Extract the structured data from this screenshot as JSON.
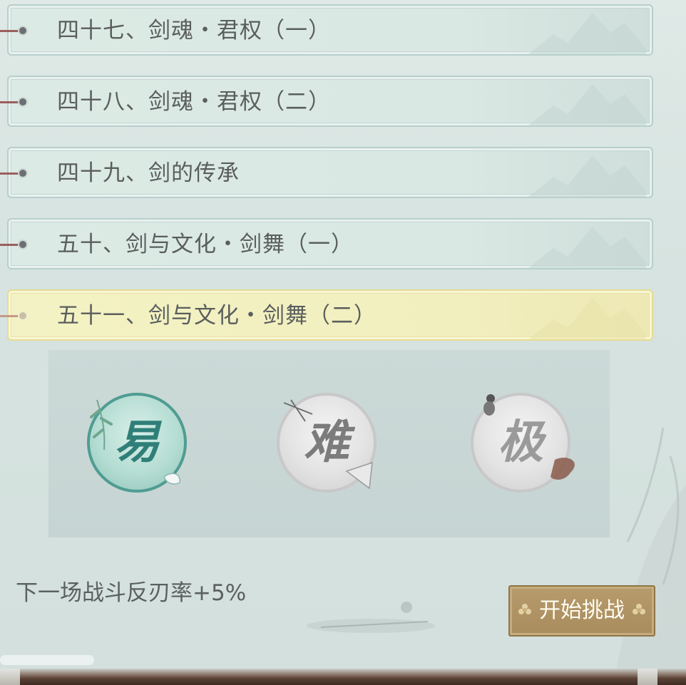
{
  "chapters": [
    {
      "label": "四十七、剑魂・君权（一）",
      "active": false
    },
    {
      "label": "四十八、剑魂・君权（二）",
      "active": false
    },
    {
      "label": "四十九、剑的传承",
      "active": false
    },
    {
      "label": "五十、剑与文化・剑舞（一）",
      "active": false
    },
    {
      "label": "五十一、剑与文化・剑舞（二）",
      "active": true
    }
  ],
  "difficulties": {
    "easy": {
      "glyph": "易"
    },
    "hard": {
      "glyph": "难"
    },
    "extreme": {
      "glyph": "极"
    }
  },
  "buff_text": "下一场战斗反刃率+5%",
  "start_button": {
    "label": "开始挑战"
  },
  "colors": {
    "active_chapter_bg": "#f2efbe",
    "chapter_bg": "#dae8e3",
    "button_bg": "#a98c5d",
    "easy_accent": "#4f9c92"
  }
}
